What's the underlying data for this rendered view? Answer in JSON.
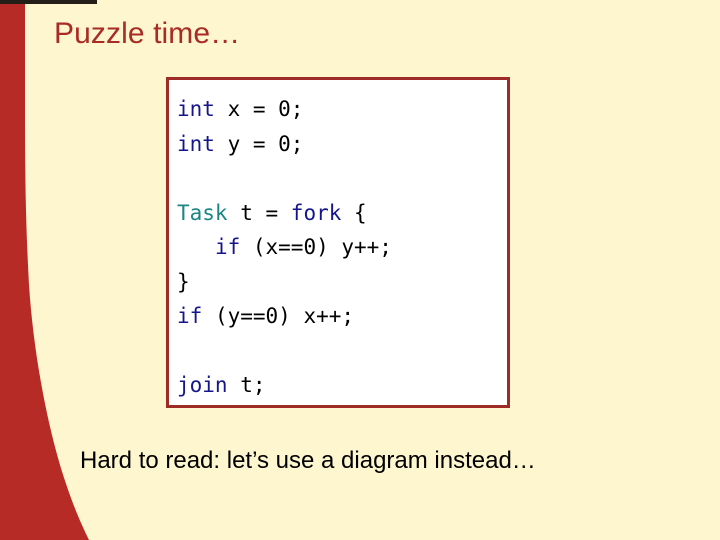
{
  "slide": {
    "title": "Puzzle time…",
    "caption": "Hard to read:  let’s use a diagram instead…",
    "background_color": "#FDF6CE",
    "accent_color": "#A92B25",
    "rule_color": "#231f18"
  },
  "code_card": {
    "border_color": "#9E2B25",
    "background_color": "#FFFFFF",
    "lines": [
      {
        "segments": [
          {
            "text": "int",
            "style": "kw"
          },
          {
            "text": " x = 0;",
            "style": "pln"
          }
        ]
      },
      {
        "segments": [
          {
            "text": "int",
            "style": "kw"
          },
          {
            "text": " y = 0;",
            "style": "pln"
          }
        ]
      },
      {
        "segments": [
          {
            "text": "",
            "style": "pln"
          }
        ]
      },
      {
        "segments": [
          {
            "text": "Task",
            "style": "type"
          },
          {
            "text": " t = ",
            "style": "pln"
          },
          {
            "text": "fork",
            "style": "kw"
          },
          {
            "text": " {",
            "style": "pln"
          }
        ]
      },
      {
        "segments": [
          {
            "text": "   ",
            "style": "pln"
          },
          {
            "text": "if",
            "style": "kw"
          },
          {
            "text": " (x==0) y++;",
            "style": "pln"
          }
        ]
      },
      {
        "segments": [
          {
            "text": "}",
            "style": "pln"
          }
        ]
      },
      {
        "segments": [
          {
            "text": "if",
            "style": "kw"
          },
          {
            "text": " (y==0) x++;",
            "style": "pln"
          }
        ]
      },
      {
        "segments": [
          {
            "text": "",
            "style": "pln"
          }
        ]
      },
      {
        "segments": [
          {
            "text": "join",
            "style": "kw"
          },
          {
            "text": " t;",
            "style": "pln"
          }
        ]
      }
    ],
    "plain_text": "int x = 0;\nint y = 0;\n\nTask t = fork {\n   if (x==0) y++;\n}\nif (y==0) x++;\n\njoin t;"
  },
  "decoration": {
    "left_curve_color": "#B72B26",
    "left_curve_label": "left-red-curve"
  }
}
